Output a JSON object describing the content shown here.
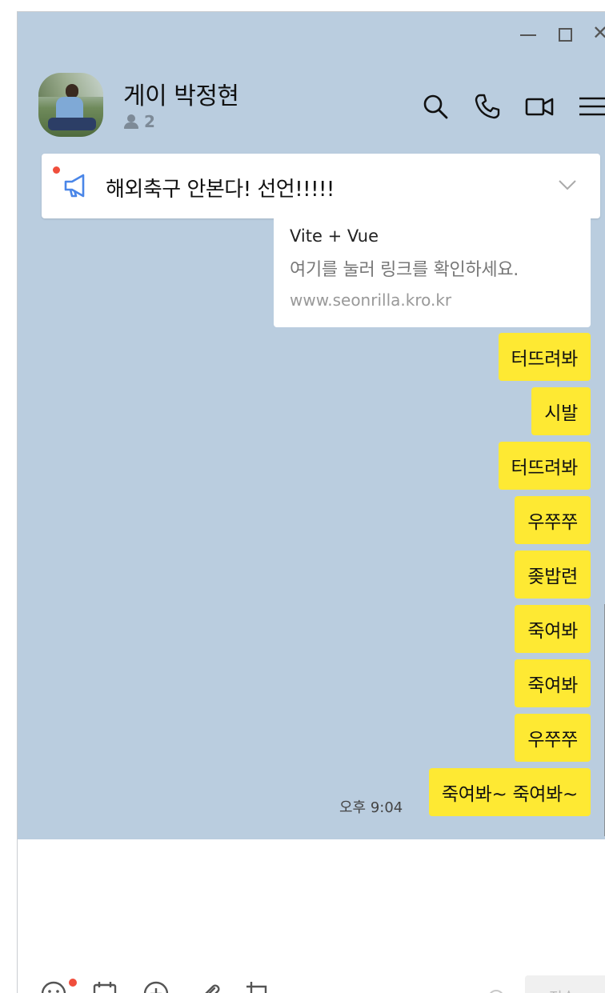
{
  "window": {
    "minimize_icon": "minimize-icon",
    "maximize_icon": "maximize-icon",
    "close_glyph": "✕"
  },
  "header": {
    "title": "게이 박정현",
    "member_count": "2",
    "icons": [
      "search-icon",
      "phone-icon",
      "video-icon",
      "menu-icon"
    ]
  },
  "notice": {
    "text": "해외축구 안본다! 선언!!!!!",
    "unread_dot_color": "#f04e3c"
  },
  "link_card": {
    "title": "Vite + Vue",
    "description": "여기를 눌러 링크를 확인하세요.",
    "url": "www.seonrilla.kro.kr"
  },
  "messages": [
    {
      "text": "터뜨려봐"
    },
    {
      "text": "시발"
    },
    {
      "text": "터뜨려봐"
    },
    {
      "text": "우쭈쭈"
    },
    {
      "text": "좆밥련"
    },
    {
      "text": "죽여봐"
    },
    {
      "text": "죽여봐"
    },
    {
      "text": "우쭈쭈"
    },
    {
      "text": "죽여봐~ 죽여봐~"
    }
  ],
  "last_timestamp": "오후 9:04",
  "input": {
    "send_label": "전송"
  },
  "colors": {
    "chat_background": "#bacddf",
    "bubble_mine": "#fee933",
    "accent_blue": "#4a86e8"
  }
}
